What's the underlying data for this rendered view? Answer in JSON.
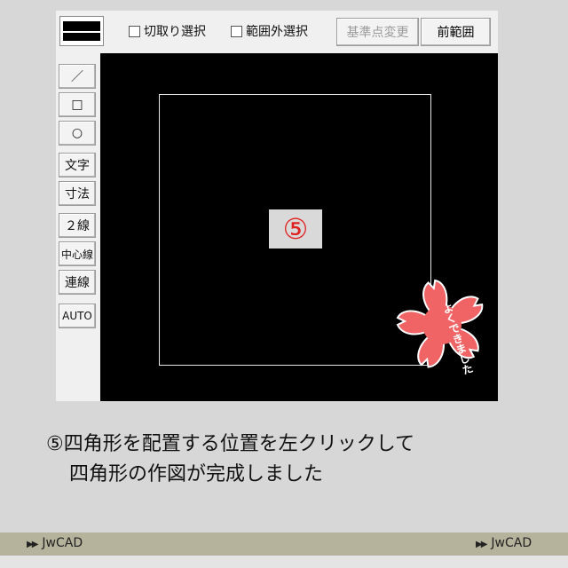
{
  "toolbar": {
    "checkbox_cut_select": "切取り選択",
    "checkbox_out_of_range_select": "範囲外選択",
    "base_point_change": "基準点変更",
    "previous_range": "前範囲"
  },
  "side_tools": {
    "line_glyph": "／",
    "rect_glyph": "□",
    "circle_glyph": "○",
    "text": "文字",
    "dimension": "寸法",
    "double_line": "２線",
    "center_line": "中心線",
    "continuous_line": "連線",
    "auto": "AUTO"
  },
  "canvas": {
    "step_marker": "⑤",
    "badge_text": "よくできました"
  },
  "caption": {
    "line1": "⑤四角形を配置する位置を左クリックして",
    "line2": "四角形の作図が完成しました"
  },
  "footer": {
    "left_label": "JwCAD",
    "right_label": "JwCAD"
  }
}
